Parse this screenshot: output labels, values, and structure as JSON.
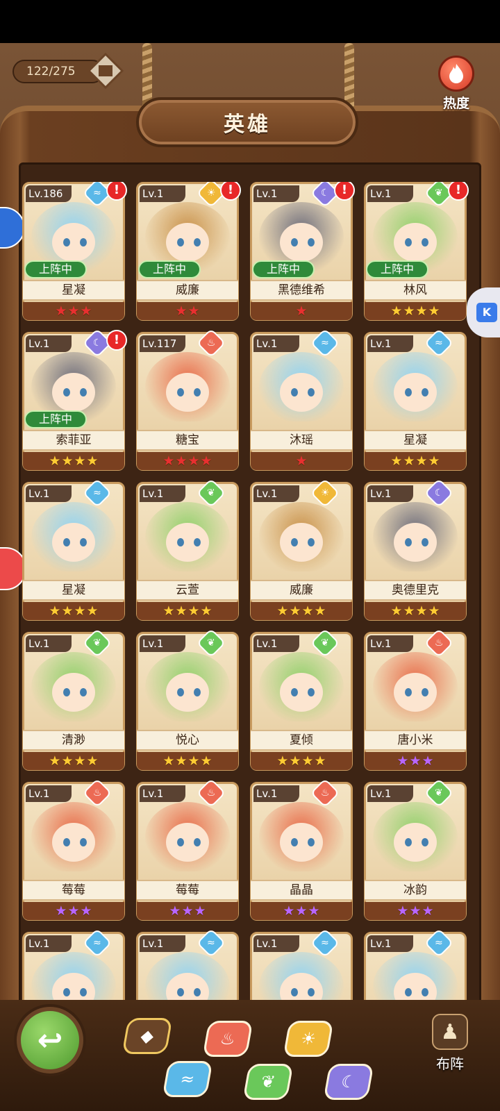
{
  "top": {
    "hero_count": "122/275",
    "title": "英雄",
    "heat_label": "热度"
  },
  "colors": {
    "water": "#5ab8e8",
    "sun": "#f0b838",
    "moon": "#8a7ae0",
    "leaf": "#6ac85a",
    "fire": "#ec6a54"
  },
  "heroes": [
    {
      "level": "Lv.186",
      "name": "星凝",
      "element": "water",
      "deployed": true,
      "alert": true,
      "stars": 3,
      "star_color": "red"
    },
    {
      "level": "Lv.1",
      "name": "威廉",
      "element": "sun",
      "deployed": true,
      "alert": true,
      "stars": 2,
      "star_color": "red"
    },
    {
      "level": "Lv.1",
      "name": "黑德维希",
      "element": "moon",
      "deployed": true,
      "alert": true,
      "stars": 1,
      "star_color": "red"
    },
    {
      "level": "Lv.1",
      "name": "林风",
      "element": "leaf",
      "deployed": true,
      "alert": true,
      "stars": 4,
      "star_color": "gold"
    },
    {
      "level": "Lv.1",
      "name": "索菲亚",
      "element": "moon",
      "deployed": true,
      "alert": true,
      "stars": 4,
      "star_color": "gold"
    },
    {
      "level": "Lv.117",
      "name": "糖宝",
      "element": "fire",
      "deployed": false,
      "alert": false,
      "stars": 4,
      "star_color": "red"
    },
    {
      "level": "Lv.1",
      "name": "沐瑶",
      "element": "water",
      "deployed": false,
      "alert": false,
      "stars": 1,
      "star_color": "red"
    },
    {
      "level": "Lv.1",
      "name": "星凝",
      "element": "water",
      "deployed": false,
      "alert": false,
      "stars": 4,
      "star_color": "gold"
    },
    {
      "level": "Lv.1",
      "name": "星凝",
      "element": "water",
      "deployed": false,
      "alert": false,
      "stars": 4,
      "star_color": "gold"
    },
    {
      "level": "Lv.1",
      "name": "云萱",
      "element": "leaf",
      "deployed": false,
      "alert": false,
      "stars": 4,
      "star_color": "gold"
    },
    {
      "level": "Lv.1",
      "name": "威廉",
      "element": "sun",
      "deployed": false,
      "alert": false,
      "stars": 4,
      "star_color": "gold"
    },
    {
      "level": "Lv.1",
      "name": "奥德里克",
      "element": "moon",
      "deployed": false,
      "alert": false,
      "stars": 4,
      "star_color": "gold"
    },
    {
      "level": "Lv.1",
      "name": "清渺",
      "element": "leaf",
      "deployed": false,
      "alert": false,
      "stars": 4,
      "star_color": "gold"
    },
    {
      "level": "Lv.1",
      "name": "悦心",
      "element": "leaf",
      "deployed": false,
      "alert": false,
      "stars": 4,
      "star_color": "gold"
    },
    {
      "level": "Lv.1",
      "name": "夏倾",
      "element": "leaf",
      "deployed": false,
      "alert": false,
      "stars": 4,
      "star_color": "gold"
    },
    {
      "level": "Lv.1",
      "name": "唐小米",
      "element": "fire",
      "deployed": false,
      "alert": false,
      "stars": 3,
      "star_color": "purple"
    },
    {
      "level": "Lv.1",
      "name": "莓莓",
      "element": "fire",
      "deployed": false,
      "alert": false,
      "stars": 3,
      "star_color": "purple"
    },
    {
      "level": "Lv.1",
      "name": "莓莓",
      "element": "fire",
      "deployed": false,
      "alert": false,
      "stars": 3,
      "star_color": "purple"
    },
    {
      "level": "Lv.1",
      "name": "晶晶",
      "element": "fire",
      "deployed": false,
      "alert": false,
      "stars": 3,
      "star_color": "purple"
    },
    {
      "level": "Lv.1",
      "name": "冰韵",
      "element": "leaf",
      "deployed": false,
      "alert": false,
      "stars": 3,
      "star_color": "purple"
    },
    {
      "level": "Lv.1",
      "name": "",
      "element": "water",
      "deployed": false,
      "alert": false,
      "stars": 0,
      "star_color": "gold"
    },
    {
      "level": "Lv.1",
      "name": "",
      "element": "water",
      "deployed": false,
      "alert": false,
      "stars": 0,
      "star_color": "gold"
    },
    {
      "level": "Lv.1",
      "name": "",
      "element": "water",
      "deployed": false,
      "alert": false,
      "stars": 0,
      "star_color": "gold"
    },
    {
      "level": "Lv.1",
      "name": "",
      "element": "water",
      "deployed": false,
      "alert": false,
      "stars": 0,
      "star_color": "gold"
    }
  ],
  "labels": {
    "deployed": "上阵中",
    "alert": "!",
    "star_glyph": "★"
  },
  "bottom": {
    "back_icon": "back-arrow-icon",
    "formation_label": "布阵",
    "filters": [
      "all",
      "water",
      "fire",
      "leaf",
      "sun",
      "moon"
    ]
  }
}
